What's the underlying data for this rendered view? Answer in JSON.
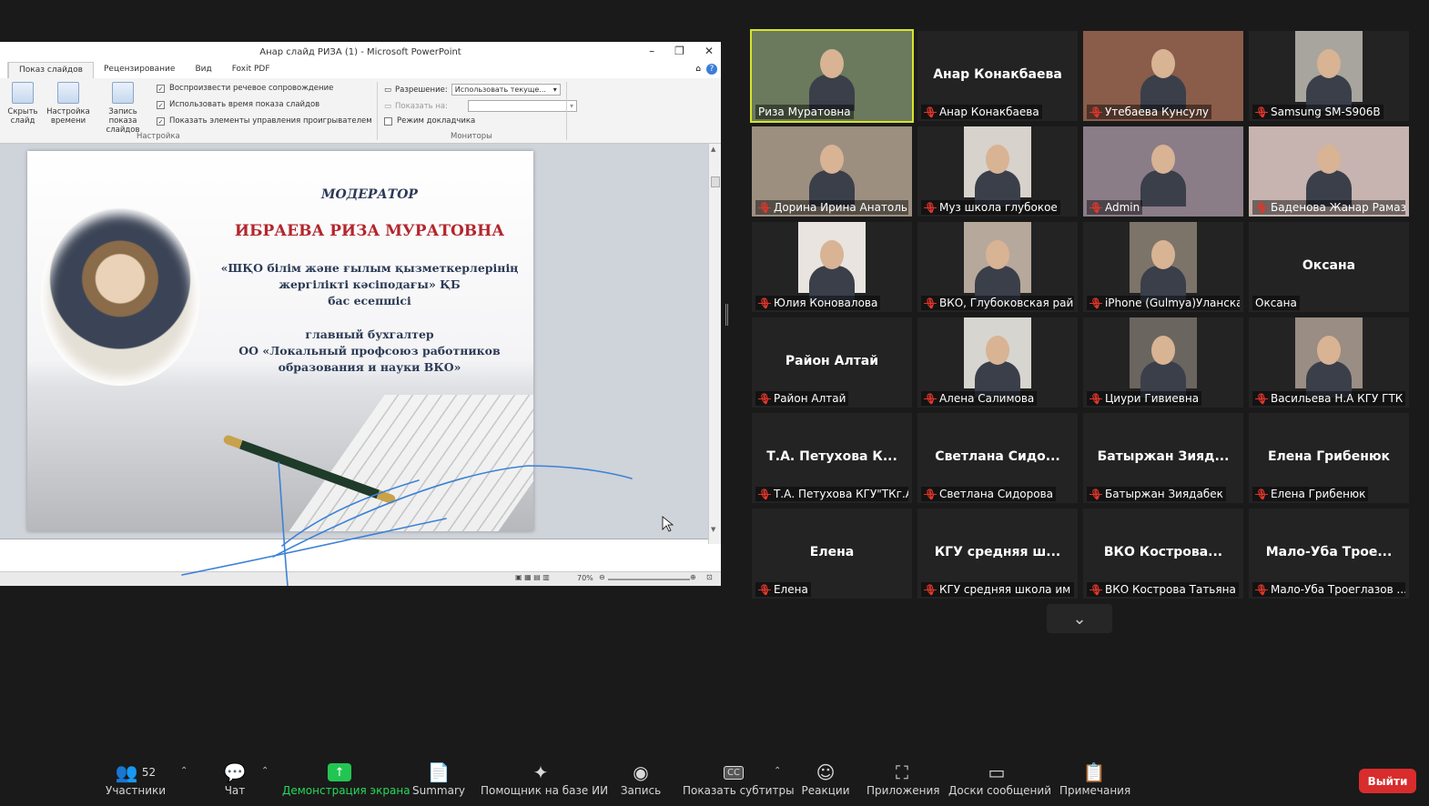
{
  "ppt": {
    "window_title": "Анар слайд РИЗА (1)  -  Microsoft PowerPoint",
    "tabs": [
      "Показ слайдов",
      "Рецензирование",
      "Вид",
      "Foxit PDF"
    ],
    "buttons": {
      "hide_slide": "Скрыть слайд",
      "timing": "Настройка времени",
      "record": "Запись показа слайдов"
    },
    "checks": {
      "narration": "Воспроизвести речевое сопровождение",
      "timings": "Использовать время показа слайдов",
      "media_controls": "Показать элементы управления проигрывателем"
    },
    "group_setup": "Настройка",
    "monitors": {
      "resolution_label": "Разрешение:",
      "resolution_value": "Использовать текуще...",
      "show_on_label": "Показать на:",
      "presenter_view": "Режим докладчика",
      "group_label": "Мониторы"
    },
    "zoom": "70%",
    "slide": {
      "moderator": "МОДЕРАТОР",
      "name": "ИБРАЕВА РИЗА МУРАТОВНА",
      "kz_line1": "«ШҚО білім және ғылым қызметкерлерінің",
      "kz_line2": "жергілікті кәсіподағы» ҚБ",
      "kz_line3": "бас есепшісі",
      "ru_line1": "главный бухгалтер",
      "ru_line2": "ОО «Локальный профсоюз работников",
      "ru_line3": "образования и науки ВКО»"
    }
  },
  "gallery": [
    {
      "label": "Риза Муратовна",
      "big": "",
      "video": true,
      "muted": false
    },
    {
      "label": "Анар Конакбаева",
      "big": "Анар Конакбаева",
      "video": false,
      "muted": true
    },
    {
      "label": "Утебаева Кунсулу",
      "big": "",
      "video": true,
      "muted": true
    },
    {
      "label": "Samsung SM-S906B",
      "big": "",
      "video": true,
      "muted": true
    },
    {
      "label": "Дорина Ирина Анатоль...",
      "big": "",
      "video": true,
      "muted": true
    },
    {
      "label": "Муз школа глубокое",
      "big": "",
      "video": true,
      "muted": true
    },
    {
      "label": "Admin",
      "big": "",
      "video": true,
      "muted": true
    },
    {
      "label": "Баденова Жанар Рамаз...",
      "big": "",
      "video": true,
      "muted": true
    },
    {
      "label": "Юлия Коновалова",
      "big": "",
      "video": true,
      "muted": true
    },
    {
      "label": "ВКО, Глубоковская рай...",
      "big": "",
      "video": true,
      "muted": true
    },
    {
      "label": "iPhone (Gulmya)Уланска...",
      "big": "",
      "video": true,
      "muted": true
    },
    {
      "label": "Оксана",
      "big": "Оксана",
      "video": false,
      "muted": false
    },
    {
      "label": "Район Алтай",
      "big": "Район Алтай",
      "video": false,
      "muted": true
    },
    {
      "label": "Алена Салимова",
      "big": "",
      "video": true,
      "muted": true
    },
    {
      "label": "Циури Гивиевна",
      "big": "",
      "video": true,
      "muted": true
    },
    {
      "label": "Васильева Н.А  КГУ ГТК",
      "big": "",
      "video": true,
      "muted": true
    },
    {
      "label": "Т.А. Петухова КГУ\"ТКг.А...",
      "big": "Т.А. Петухова К...",
      "video": false,
      "muted": true
    },
    {
      "label": "Светлана Сидорова",
      "big": "Светлана  Сидо...",
      "video": false,
      "muted": true
    },
    {
      "label": "Батыржан Зиядабек",
      "big": "Батыржан  Зияд...",
      "video": false,
      "muted": true
    },
    {
      "label": "Елена Грибенюк",
      "big": "Елена Грибенюк",
      "video": false,
      "muted": true
    },
    {
      "label": "Елена",
      "big": "Елена",
      "video": false,
      "muted": true
    },
    {
      "label": "КГУ средняя школа им ...",
      "big": "КГУ средняя ш...",
      "video": false,
      "muted": true
    },
    {
      "label": "ВКО Кострова Татьяна",
      "big": "ВКО  Кострова...",
      "video": false,
      "muted": true
    },
    {
      "label": "Мало-Уба Троеглазов ...",
      "big": "Мало-Уба  Трое...",
      "video": false,
      "muted": true
    }
  ],
  "toolbar": {
    "participants_count": "52",
    "participants": "Участники",
    "chat": "Чат",
    "share": "Демонстрация экрана",
    "summary": "Summary",
    "ai": "Помощник на базе ИИ",
    "record": "Запись",
    "captions": "Показать субтитры",
    "captions_icon": "CC",
    "reactions": "Реакции",
    "apps": "Приложения",
    "whiteboards": "Доски сообщений",
    "notes": "Примечания",
    "leave": "Выйти"
  },
  "colors": {
    "active_speaker": "#d9e32a",
    "share_green": "#23c552",
    "leave_red": "#d92c2c",
    "mic_off": "#e0362b"
  }
}
